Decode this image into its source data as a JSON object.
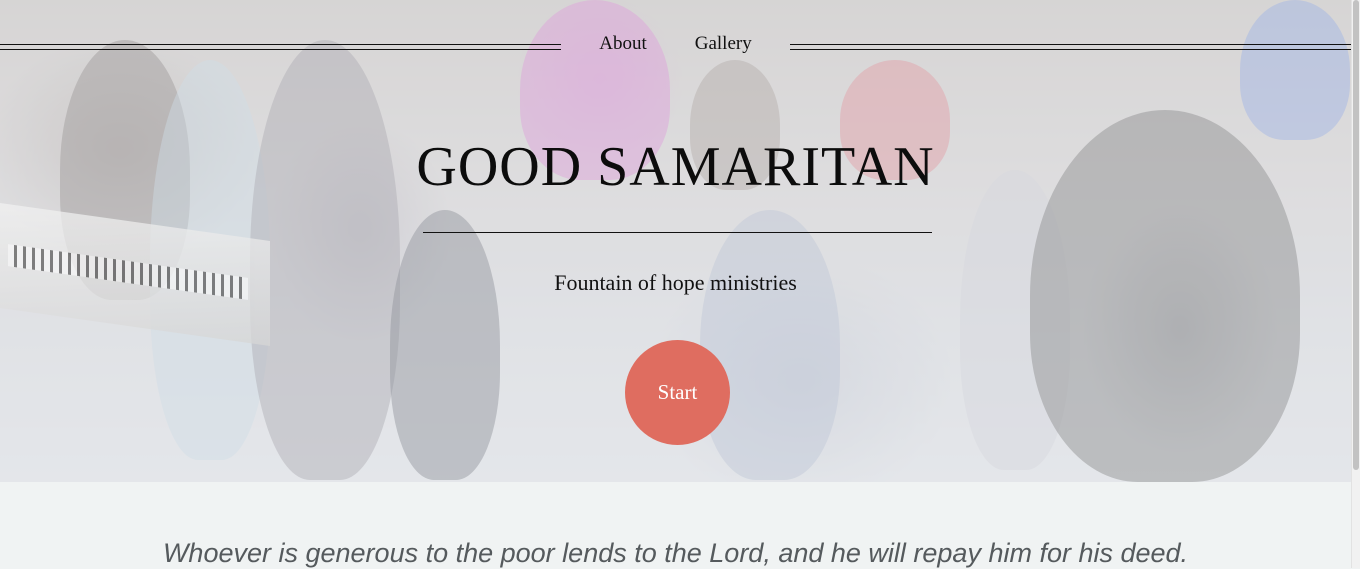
{
  "nav": {
    "items": [
      {
        "label": "About"
      },
      {
        "label": "Gallery"
      }
    ]
  },
  "hero": {
    "title": "GOOD SAMARITAN",
    "subtitle": "Fountain of hope ministries",
    "start_label": "Start",
    "start_color": "#df6d60"
  },
  "quote": {
    "text": "Whoever is generous to the poor lends to the Lord, and he will repay him for his deed."
  }
}
